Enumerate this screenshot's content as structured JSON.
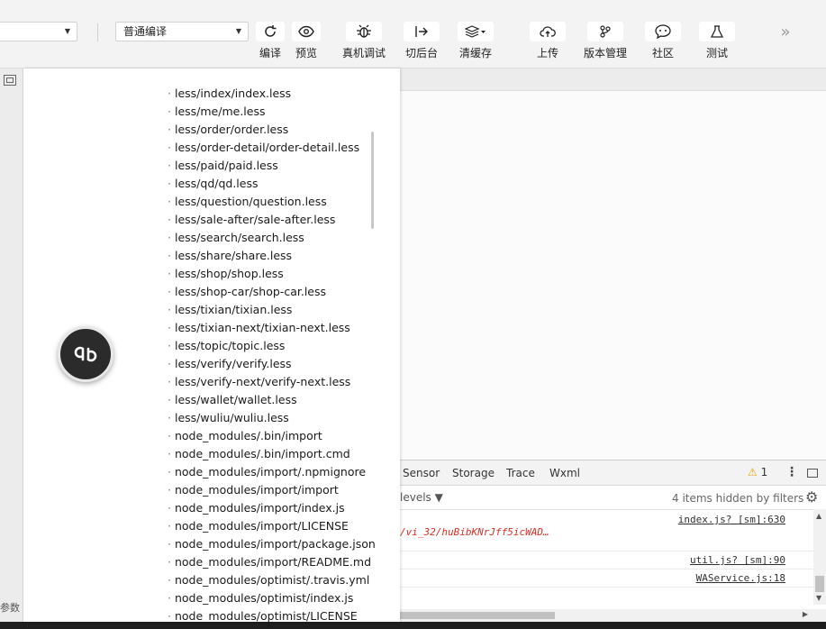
{
  "toolbar": {
    "compile_mode": "普通编译",
    "buttons": [
      {
        "label": "编译",
        "icon": "refresh-icon"
      },
      {
        "label": "预览",
        "icon": "eye-icon"
      },
      {
        "label": "真机调试",
        "icon": "bug-icon"
      },
      {
        "label": "切后台",
        "icon": "switch-background-icon"
      },
      {
        "label": "清缓存",
        "icon": "layers-icon"
      },
      {
        "label": "上传",
        "icon": "cloud-upload-icon"
      },
      {
        "label": "版本管理",
        "icon": "branch-icon"
      },
      {
        "label": "社区",
        "icon": "chat-icon"
      },
      {
        "label": "测试",
        "icon": "flask-icon"
      }
    ],
    "more_label": "»"
  },
  "sidebar": {
    "params_label": "参数"
  },
  "overlay": {
    "files": [
      "less/index/index.less",
      "less/me/me.less",
      "less/order/order.less",
      "less/order-detail/order-detail.less",
      "less/paid/paid.less",
      "less/qd/qd.less",
      "less/question/question.less",
      "less/sale-after/sale-after.less",
      "less/search/search.less",
      "less/share/share.less",
      "less/shop/shop.less",
      "less/shop-car/shop-car.less",
      "less/tixian/tixian.less",
      "less/tixian-next/tixian-next.less",
      "less/topic/topic.less",
      "less/verify/verify.less",
      "less/verify-next/verify-next.less",
      "less/wallet/wallet.less",
      "less/wuliu/wuliu.less",
      "node_modules/.bin/import",
      "node_modules/.bin/import.cmd",
      "node_modules/import/.npmignore",
      "node_modules/import/import",
      "node_modules/import/index.js",
      "node_modules/import/LICENSE",
      "node_modules/import/package.json",
      "node_modules/import/README.md",
      "node_modules/optimist/.travis.yml",
      "node_modules/optimist/index.js",
      "node_modules/optimist/LICENSE"
    ],
    "bullet": "·"
  },
  "devtools": {
    "tabs": [
      "Sensor",
      "Storage",
      "Trace",
      "Wxml"
    ],
    "warning_count": "1",
    "levels_label": "levels ▼",
    "hidden_info": "4 items hidden by filters",
    "rows": [
      {
        "source": "index.js? [sm]:630",
        "error": "/vi_32/huBibKNrJff5icWAD…"
      },
      {
        "source": "util.js? [sm]:90",
        "error": ""
      },
      {
        "source": "WAService.js:18",
        "error": ""
      }
    ]
  }
}
